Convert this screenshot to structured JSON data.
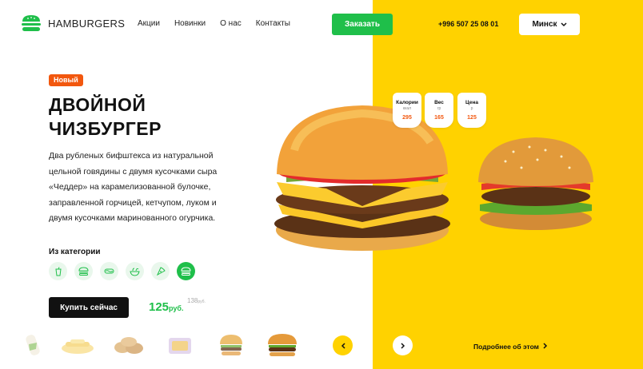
{
  "header": {
    "logo_text": "HAMBURGERS",
    "nav": [
      "Акции",
      "Новинки",
      "О нас",
      "Контакты"
    ],
    "order_label": "Заказать",
    "phone": "+996 507 25 08 01",
    "city": "Минск"
  },
  "hero": {
    "badge": "Новый",
    "title_line1": "ДВОЙНОЙ",
    "title_line2": "ЧИЗБУРГЕР",
    "description": "Два рубленых бифштекса из натуральной цельной говядины с двумя кусочками сыра «Чеддер» на карамелизованной булочке, заправленной горчицей, кетчупом, луком и двумя кусочками маринованного огурчика.",
    "categories_title": "Из категории",
    "categories": [
      "drink-icon",
      "burger-icon",
      "hotdog-icon",
      "salad-icon",
      "pizza-icon",
      "burger-icon"
    ],
    "buy_label": "Купить сейчас",
    "price": "125",
    "price_currency": "руб.",
    "old_price": "138",
    "old_price_currency": "руб."
  },
  "info": [
    {
      "label": "Калории",
      "unit": "ккал",
      "value": "295"
    },
    {
      "label": "Вес",
      "unit": "гр",
      "value": "165"
    },
    {
      "label": "Цена",
      "unit": "р",
      "value": "125"
    }
  ],
  "footer": {
    "more_label": "Подробнее об этом",
    "thumbs": [
      "roll-thumb",
      "fries-thumb",
      "nuggets-thumb",
      "box-thumb",
      "burger-thumb",
      "burger-thumb"
    ]
  },
  "colors": {
    "accent": "#1FBF4A",
    "yellow": "#FFD200",
    "badge": "#F2570E"
  }
}
